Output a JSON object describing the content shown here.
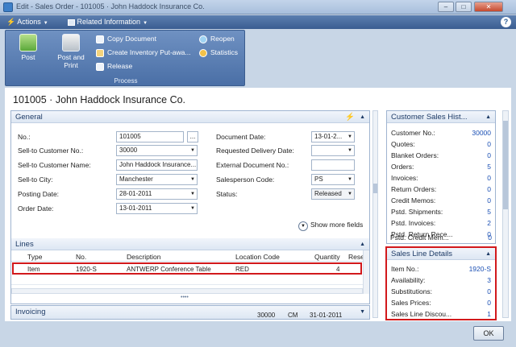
{
  "window": {
    "title": "Edit - Sales Order - 101005 · John Haddock Insurance Co.",
    "min": "–",
    "max": "□",
    "close": "✕"
  },
  "menu": {
    "actions": "Actions",
    "related": "Related Information",
    "help": "?"
  },
  "ribbon": {
    "post": "Post",
    "post_print": "Post and Print",
    "copy_document": "Copy Document",
    "create_inventory": "Create Inventory Put-awa...",
    "release": "Release",
    "reopen": "Reopen",
    "statistics": "Statistics",
    "group": "Process"
  },
  "page_title": "101005 · John Haddock Insurance Co.",
  "general": {
    "title": "General",
    "no_label": "No.:",
    "no_value": "101005",
    "assist": "...",
    "sell_to_customer_no_label": "Sell-to Customer No.:",
    "sell_to_customer_no_value": "30000",
    "sell_to_customer_name_label": "Sell-to Customer Name:",
    "sell_to_customer_name_value": "John Haddock Insurance...",
    "sell_to_city_label": "Sell-to City:",
    "sell_to_city_value": "Manchester",
    "posting_date_label": "Posting Date:",
    "posting_date_value": "28-01-2011",
    "order_date_label": "Order Date:",
    "order_date_value": "13-01-2011",
    "document_date_label": "Document Date:",
    "document_date_value": "13-01-2...",
    "requested_delivery_label": "Requested Delivery Date:",
    "requested_delivery_value": "",
    "external_doc_label": "External Document No.:",
    "external_doc_value": "",
    "salesperson_label": "Salesperson Code:",
    "salesperson_value": "PS",
    "status_label": "Status:",
    "status_value": "Released",
    "show_more": "Show more fields"
  },
  "lines": {
    "title": "Lines",
    "columns": [
      "Type",
      "No.",
      "Description",
      "Location Code",
      "Quantity",
      "Rese"
    ],
    "rows": [
      {
        "type": "Item",
        "no": "1920-S",
        "description": "ANTWERP Conference Table",
        "location": "RED",
        "quantity": "4"
      }
    ]
  },
  "invoicing": {
    "title": "Invoicing",
    "amount": "30000",
    "code": "CM",
    "date": "31-01-2011"
  },
  "customer_sales_history": {
    "title": "Customer Sales Hist...",
    "rows": [
      {
        "label": "Customer No.:",
        "value": "30000"
      },
      {
        "label": "Quotes:",
        "value": "0"
      },
      {
        "label": "Blanket Orders:",
        "value": "0"
      },
      {
        "label": "Orders:",
        "value": "5"
      },
      {
        "label": "Invoices:",
        "value": "0"
      },
      {
        "label": "Return Orders:",
        "value": "0"
      },
      {
        "label": "Credit Memos:",
        "value": "0"
      },
      {
        "label": "Pstd. Shipments:",
        "value": "5"
      },
      {
        "label": "Pstd. Invoices:",
        "value": "2"
      },
      {
        "label": "Pstd. Return Rece...",
        "value": "0"
      },
      {
        "label": "Pstd. Credit Mem...",
        "value": "0"
      }
    ]
  },
  "sales_line_details": {
    "title": "Sales Line Details",
    "rows": [
      {
        "label": "Item No.:",
        "value": "1920-S"
      },
      {
        "label": "Availability:",
        "value": "3"
      },
      {
        "label": "Substitutions:",
        "value": "0"
      },
      {
        "label": "Sales Prices:",
        "value": "0"
      },
      {
        "label": "Sales Line Discou...",
        "value": "1"
      }
    ]
  },
  "ok": "OK",
  "colors": {
    "accent": "#1e3b66",
    "link": "#1a4fb4",
    "highlight": "#d2191c"
  }
}
